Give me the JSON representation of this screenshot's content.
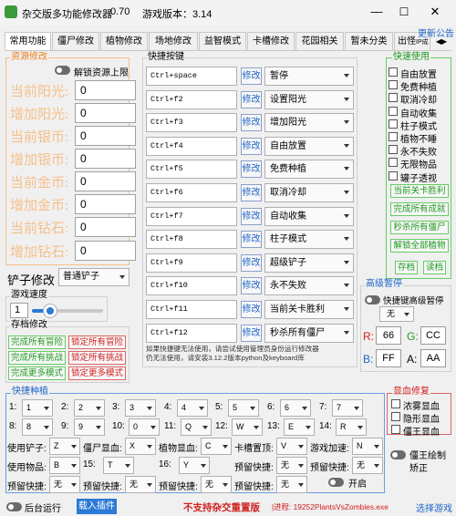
{
  "window": {
    "title": "杂交版多功能修改器",
    "version": "0.70",
    "game_version": "游戏版本：3.14",
    "update_link": "更新公告"
  },
  "tabs": [
    "常用功能",
    "僵尸修改",
    "植物修改",
    "场地修改",
    "益智模式",
    "卡槽修改",
    "花园相关",
    "暂未分类",
    "出怪"
  ],
  "tab_overflow": "IP成",
  "resources": {
    "group_label": "资源修改",
    "unlock_label": "解锁资源上限",
    "rows": [
      {
        "label": "当前阳光:",
        "value": "0"
      },
      {
        "label": "增加阳光:",
        "value": "0"
      },
      {
        "label": "当前银币:",
        "value": "0"
      },
      {
        "label": "增加银币:",
        "value": "0"
      },
      {
        "label": "当前金币:",
        "value": "0"
      },
      {
        "label": "增加金币:",
        "value": "0"
      },
      {
        "label": "当前钻石:",
        "value": "0"
      },
      {
        "label": "增加钻石:",
        "value": "0"
      }
    ]
  },
  "shovel": {
    "label": "铲子修改",
    "value": "普通铲子"
  },
  "speed": {
    "group_label": "游戏速度",
    "value": "1",
    "level_fraction": 0.25
  },
  "saves": {
    "group_label": "存档修改",
    "buttons": [
      "完成所有冒险",
      "锁定所有冒险",
      "完成所有挑战",
      "锁定所有挑战",
      "完成更多模式",
      "锁定更多模式"
    ]
  },
  "hotkeys": {
    "group_label": "快捷按键",
    "modify_label": "修改",
    "rows": [
      {
        "key": "Ctrl+space",
        "action": "暂停"
      },
      {
        "key": "Ctrl+f2",
        "action": "设置阳光"
      },
      {
        "key": "Ctrl+f3",
        "action": "增加阳光"
      },
      {
        "key": "Ctrl+f4",
        "action": "自由放置"
      },
      {
        "key": "Ctrl+f5",
        "action": "免费种植"
      },
      {
        "key": "Ctrl+f6",
        "action": "取消冷却"
      },
      {
        "key": "Ctrl+f7",
        "action": "自动收集"
      },
      {
        "key": "Ctrl+f8",
        "action": "柱子模式"
      },
      {
        "key": "Ctrl+f9",
        "action": "超级铲子"
      },
      {
        "key": "Ctrl+f10",
        "action": "永不失败"
      },
      {
        "key": "Ctrl+f11",
        "action": "当前关卡胜利"
      },
      {
        "key": "Ctrl+f12",
        "action": "秒杀所有僵尸"
      }
    ],
    "note_line1": "如果快捷键无法使用，请尝试使用管理员身份运行修改器",
    "note_line2": "仍无法使用，请安装3.12.2版本python及keyboard库"
  },
  "quick_use": {
    "group_label": "快速使用",
    "checks": [
      "自由放置",
      "免费种植",
      "取消冷却",
      "自动收集",
      "柱子模式",
      "植物不睡",
      "永不失败",
      "无限物品",
      "罐子透视"
    ],
    "buttons": [
      "当前关卡胜利",
      "完成所有成就",
      "秒杀所有僵尸",
      "解锁全部植物"
    ],
    "save_label": "存档",
    "load_label": "读档"
  },
  "advanced_pause": {
    "group_label": "高级暂停",
    "toggle_label": "快捷键高级暂停",
    "select": "无",
    "r_label": "R:",
    "r_value": "66",
    "g_label": "G:",
    "g_value": "CC",
    "b_label": "B:",
    "b_value": "FF",
    "a_label": "A:",
    "a_value": "AA"
  },
  "quick_plant": {
    "group_label": "快捷种植",
    "rows": [
      [
        {
          "n": "1:",
          "v": "1"
        },
        {
          "n": "2:",
          "v": "2"
        },
        {
          "n": "3:",
          "v": "3"
        },
        {
          "n": "4:",
          "v": "4"
        },
        {
          "n": "5:",
          "v": "5"
        },
        {
          "n": "6:",
          "v": "6"
        },
        {
          "n": "7:",
          "v": "7"
        }
      ],
      [
        {
          "n": "8:",
          "v": "8"
        },
        {
          "n": "9:",
          "v": "9"
        },
        {
          "n": "10:",
          "v": "0"
        },
        {
          "n": "11:",
          "v": "Q"
        },
        {
          "n": "12:",
          "v": "W"
        },
        {
          "n": "13:",
          "v": "E"
        },
        {
          "n": "14:",
          "v": "R"
        }
      ]
    ],
    "controls_row3": [
      {
        "n": "使用铲子:",
        "v": "Z"
      },
      {
        "n": "僵尸显血:",
        "v": "X"
      },
      {
        "n": "植物显血:",
        "v": "C"
      },
      {
        "n": "卡槽置顶:",
        "v": "V"
      },
      {
        "n": "游戏加速:",
        "v": "N"
      }
    ],
    "controls_row4": [
      {
        "n": "使用物品:",
        "v": "B"
      },
      {
        "n": "15:",
        "v": "T"
      },
      {
        "n": "16:",
        "v": "Y"
      },
      {
        "n": "预留快捷:",
        "v": "无"
      },
      {
        "n": "预留快捷:",
        "v": "无"
      }
    ],
    "controls_row5": [
      {
        "n": "预留快捷:",
        "v": "无"
      },
      {
        "n": "预留快捷:",
        "v": "无"
      },
      {
        "n": "预留快捷:",
        "v": "无"
      },
      {
        "n": "预留快捷:",
        "v": "无"
      }
    ],
    "enable_label": "开启"
  },
  "display": {
    "group_label": "显血修复",
    "checks": [
      "浓雾显血",
      "隐形显血",
      "僵王显血"
    ],
    "fix_label_1": "僵王绘制",
    "fix_label_2": "矫正"
  },
  "footer": {
    "background_label": "后台运行",
    "load_plugin": "载入插件",
    "notice": "不支持杂交重置版",
    "process": "|进程: 19252PlantsVsZombies.exe",
    "select_game": "选择游戏"
  },
  "colors": {
    "orange": "#f6c08a",
    "green": "#1e9a1e",
    "red": "#d02020",
    "blue": "#1e64c8",
    "accent_blue": "#2a7ad6"
  }
}
